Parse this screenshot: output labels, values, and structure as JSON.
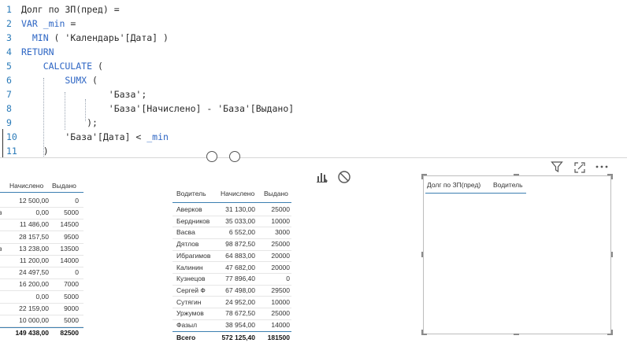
{
  "editor": {
    "lines": [
      {
        "num": "1",
        "parts": [
          {
            "t": "Долг по ЗП(пред) =",
            "c": ""
          }
        ]
      },
      {
        "num": "2",
        "parts": [
          {
            "t": "VAR _min",
            "c": "kw"
          },
          {
            "t": " =",
            "c": ""
          }
        ]
      },
      {
        "num": "3",
        "parts": [
          {
            "t": "  MIN",
            "c": "fn"
          },
          {
            "t": " ( 'Календарь'[Дата] )",
            "c": ""
          }
        ]
      },
      {
        "num": "4",
        "parts": [
          {
            "t": "RETURN",
            "c": "kw"
          }
        ]
      },
      {
        "num": "5",
        "parts": [
          {
            "t": "    CALCULATE",
            "c": "fn"
          },
          {
            "t": " (",
            "c": ""
          }
        ]
      },
      {
        "num": "6",
        "parts": [
          {
            "t": "        SUMX",
            "c": "fn"
          },
          {
            "t": " (",
            "c": ""
          }
        ]
      },
      {
        "num": "7",
        "parts": [
          {
            "t": "                'База';",
            "c": ""
          }
        ]
      },
      {
        "num": "8",
        "parts": [
          {
            "t": "                'База'[Начислено] - 'База'[Выдано]",
            "c": ""
          }
        ]
      },
      {
        "num": "9",
        "parts": [
          {
            "t": "            );",
            "c": ""
          }
        ]
      },
      {
        "num": "10",
        "parts": [
          {
            "t": "        'База'[Дата] < ",
            "c": ""
          },
          {
            "t": "_min",
            "c": "var"
          }
        ]
      },
      {
        "num": "11",
        "parts": [
          {
            "t": "    )",
            "c": ""
          }
        ]
      }
    ]
  },
  "left_table": {
    "headers": [
      "Начислено",
      "Выдано"
    ],
    "rows": [
      {
        "stub": "",
        "a": "12 500,00",
        "b": "0"
      },
      {
        "stub": "в",
        "a": "0,00",
        "b": "5000"
      },
      {
        "stub": "",
        "a": "11 486,00",
        "b": "14500"
      },
      {
        "stub": "",
        "a": "28 157,50",
        "b": "9500"
      },
      {
        "stub": "в",
        "a": "13 238,00",
        "b": "13500"
      },
      {
        "stub": "",
        "a": "11 200,00",
        "b": "14000"
      },
      {
        "stub": "",
        "a": "24 497,50",
        "b": "0"
      },
      {
        "stub": "",
        "a": "16 200,00",
        "b": "7000"
      },
      {
        "stub": "",
        "a": "0,00",
        "b": "5000"
      },
      {
        "stub": "",
        "a": "22 159,00",
        "b": "9000"
      },
      {
        "stub": "",
        "a": "10 000,00",
        "b": "5000"
      }
    ],
    "total": {
      "a": "149 438,00",
      "b": "82500"
    }
  },
  "mid_table": {
    "headers": [
      "Водитель",
      "Начислено",
      "Выдано"
    ],
    "rows": [
      {
        "name": "Аверков",
        "a": "31 130,00",
        "b": "25000"
      },
      {
        "name": "Бердников",
        "a": "35 033,00",
        "b": "10000"
      },
      {
        "name": "Васва",
        "a": "6 552,00",
        "b": "3000"
      },
      {
        "name": "Дятлов",
        "a": "98 872,50",
        "b": "25000"
      },
      {
        "name": "Ибрагимов",
        "a": "64 883,00",
        "b": "20000"
      },
      {
        "name": "Калинин",
        "a": "47 682,00",
        "b": "20000"
      },
      {
        "name": "Кузнецов",
        "a": "77 896,40",
        "b": "0"
      },
      {
        "name": "Сергей Ф",
        "a": "67 498,00",
        "b": "29500"
      },
      {
        "name": "Сутягин",
        "a": "24 952,00",
        "b": "10000"
      },
      {
        "name": "Уржумов",
        "a": "78 672,50",
        "b": "25000"
      },
      {
        "name": "Фазыл",
        "a": "38 954,00",
        "b": "14000"
      }
    ],
    "total": {
      "name": "Всего",
      "a": "572 125,40",
      "b": "181500"
    }
  },
  "empty_visual": {
    "headers": [
      "Долг по ЗП(пред)",
      "Водитель"
    ]
  },
  "icons": {
    "format_icon": "bar-chart-edit-icon",
    "block_icon": "no-entry-icon",
    "filter_icon": "filter-icon",
    "focus_icon": "focus-mode-icon",
    "more_icon": "more-options-icon"
  },
  "colors": {
    "accent": "#3c7fb1",
    "keyword": "#2e66c4",
    "line_number": "#2b7bb9"
  }
}
